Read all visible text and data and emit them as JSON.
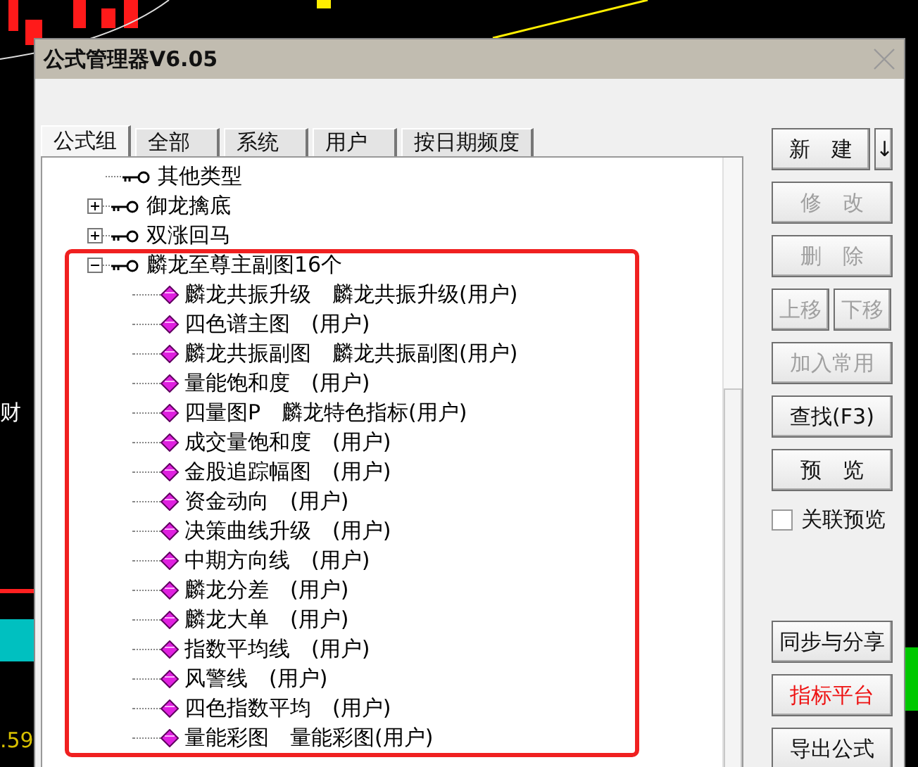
{
  "background": {
    "labels": [
      {
        "text": "财"
      },
      {
        "text": ".59"
      }
    ]
  },
  "window": {
    "title": "公式管理器V6.05"
  },
  "tabs": [
    {
      "label": "公式组",
      "selected": true
    },
    {
      "label": "全部",
      "selected": false
    },
    {
      "label": "系统",
      "selected": false
    },
    {
      "label": "用户",
      "selected": false
    },
    {
      "label": "按日期频度",
      "selected": false
    }
  ],
  "tree": [
    {
      "kind": "leaf",
      "label": "其他类型"
    },
    {
      "kind": "folder",
      "label": "御龙擒底",
      "expanded": false
    },
    {
      "kind": "folder",
      "label": "双涨回马",
      "expanded": false
    },
    {
      "kind": "folder",
      "label": "麟龙至尊主副图16个",
      "expanded": true,
      "highlighted": true,
      "children": [
        {
          "label": "麟龙共振升级　麟龙共振升级(用户)"
        },
        {
          "label": "四色谱主图　(用户)"
        },
        {
          "label": "麟龙共振副图　麟龙共振副图(用户)"
        },
        {
          "label": "量能饱和度　(用户)"
        },
        {
          "label": "四量图P　麟龙特色指标(用户)"
        },
        {
          "label": "成交量饱和度　(用户)"
        },
        {
          "label": "金股追踪幅图　(用户)"
        },
        {
          "label": "资金动向　(用户)"
        },
        {
          "label": "决策曲线升级　(用户)"
        },
        {
          "label": "中期方向线　(用户)"
        },
        {
          "label": "麟龙分差　(用户)"
        },
        {
          "label": "麟龙大单　(用户)"
        },
        {
          "label": "指数平均线　(用户)"
        },
        {
          "label": "风警线　(用户)"
        },
        {
          "label": "四色指数平均　(用户)"
        },
        {
          "label": "量能彩图　量能彩图(用户)"
        }
      ]
    }
  ],
  "buttons": [
    {
      "kind": "split",
      "label": "新　建",
      "arrow": "↓",
      "disabled": false
    },
    {
      "kind": "normal",
      "label": "修　改",
      "disabled": true
    },
    {
      "kind": "normal",
      "label": "删　除",
      "disabled": true
    },
    {
      "kind": "pair",
      "items": [
        {
          "label": "上移",
          "disabled": true
        },
        {
          "label": "下移",
          "disabled": true
        }
      ]
    },
    {
      "kind": "normal",
      "label": "加入常用",
      "disabled": true
    },
    {
      "kind": "normal",
      "label": "查找(F3)",
      "disabled": false
    },
    {
      "kind": "normal",
      "label": "预　览",
      "disabled": false
    },
    {
      "kind": "checkbox",
      "label": "关联预览",
      "checked": false
    },
    {
      "kind": "spacer"
    },
    {
      "kind": "normal",
      "label": "同步与分享",
      "disabled": false
    },
    {
      "kind": "accent",
      "label": "指标平台",
      "disabled": false
    },
    {
      "kind": "normal",
      "label": "导出公式",
      "disabled": false
    }
  ]
}
